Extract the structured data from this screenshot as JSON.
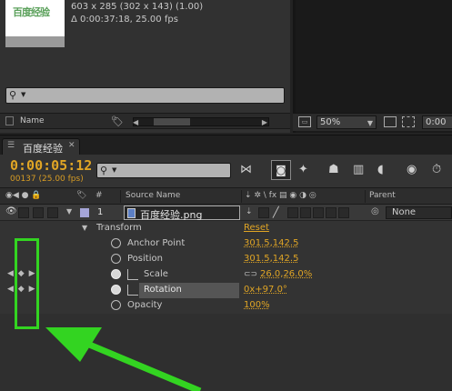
{
  "project": {
    "thumbnail_text": "百度经验",
    "info_lines": [
      "603 x 285  (302 x 143) (1.00)",
      "Δ 0:00:37:18, 25.00 fps"
    ],
    "column_name": "Name"
  },
  "viewer": {
    "zoom": "50%",
    "timecode_partial": "0:00"
  },
  "timeline": {
    "tab_label": "百度经验",
    "timecode": "0:00:05:12",
    "frame_info": "00137 (25.00 fps)",
    "columns": {
      "num": "#",
      "source_name": "Source Name",
      "switches": "⇣ ✲ \\ fx ▤ ◉ ◑ ◎",
      "parent": "Parent"
    },
    "layer": {
      "number": "1",
      "name": "百度经验.png",
      "parent": "None"
    },
    "transform": {
      "label": "Transform",
      "reset": "Reset",
      "properties": [
        {
          "label": "Anchor Point",
          "value": "301.5,142.5",
          "keyframed": false
        },
        {
          "label": "Position",
          "value": "301.5,142.5",
          "keyframed": false
        },
        {
          "label": "Scale",
          "value": "26.0,26.0%",
          "keyframed": true
        },
        {
          "label": "Rotation",
          "value": "0x+97.0°",
          "keyframed": true
        },
        {
          "label": "Opacity",
          "value": "100%",
          "keyframed": false
        }
      ]
    }
  },
  "annotation": {
    "highlight_color": "#33d421",
    "arrow_color": "#33d421"
  },
  "colors": {
    "timecode": "#e0a525",
    "panel_bg": "#333333",
    "layer_label": "#a5a5d8"
  }
}
